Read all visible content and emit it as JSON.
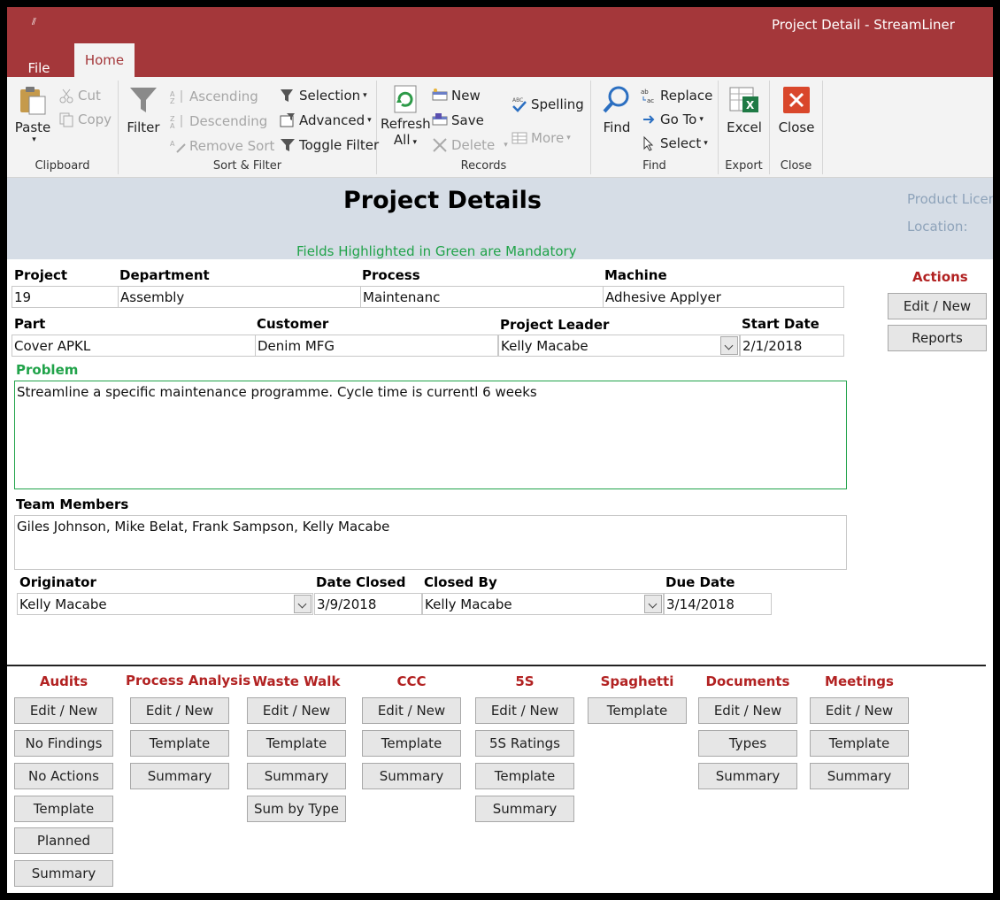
{
  "window": {
    "title": "Project Detail  -  StreamLiner",
    "qat_symbol": "⫽"
  },
  "tabs": {
    "file": "File",
    "home": "Home"
  },
  "ribbon": {
    "clipboard": {
      "label": "Clipboard",
      "paste": "Paste",
      "cut": "Cut",
      "copy": "Copy"
    },
    "sort_filter": {
      "label": "Sort & Filter",
      "filter": "Filter",
      "ascending": "Ascending",
      "descending": "Descending",
      "remove_sort": "Remove Sort",
      "selection": "Selection",
      "advanced": "Advanced",
      "toggle_filter": "Toggle Filter"
    },
    "records": {
      "label": "Records",
      "refresh": "Refresh",
      "refresh_all": "All",
      "new": "New",
      "save": "Save",
      "delete": "Delete",
      "spelling": "Spelling",
      "more": "More"
    },
    "find": {
      "label": "Find",
      "find": "Find",
      "replace": "Replace",
      "goto": "Go To",
      "select": "Select"
    },
    "export": {
      "label": "Export",
      "excel": "Excel"
    },
    "close": {
      "label": "Close",
      "close": "Close"
    }
  },
  "form": {
    "title": "Project Details",
    "mandatory_note": "Fields Highlighted in Green are Mandatory",
    "product_licence": "Product Licen",
    "location": "Location:",
    "project": {
      "label": "Project",
      "value": "19"
    },
    "department": {
      "label": "Department",
      "value": "Assembly"
    },
    "process": {
      "label": "Process",
      "value": "Maintenanc"
    },
    "machine": {
      "label": "Machine",
      "value": "Adhesive Applyer"
    },
    "part": {
      "label": "Part",
      "value": "Cover APKL"
    },
    "customer": {
      "label": "Customer",
      "value": "Denim MFG"
    },
    "project_leader": {
      "label": "Project Leader",
      "value": "Kelly Macabe"
    },
    "start_date": {
      "label": "Start Date",
      "value": "2/1/2018"
    },
    "problem": {
      "label": "Problem",
      "value": "Streamline a specific maintenance programme. Cycle time is currentl 6 weeks"
    },
    "team_members": {
      "label": "Team Members",
      "value": "Giles Johnson, Mike Belat, Frank Sampson, Kelly Macabe"
    },
    "originator": {
      "label": "Originator",
      "value": "Kelly Macabe"
    },
    "date_closed": {
      "label": "Date Closed",
      "value": "3/9/2018"
    },
    "closed_by": {
      "label": "Closed By",
      "value": "Kelly Macabe"
    },
    "due_date": {
      "label": "Due Date",
      "value": "3/14/2018"
    }
  },
  "actions": {
    "label": "Actions",
    "edit_new": "Edit / New",
    "reports": "Reports"
  },
  "sections": [
    {
      "title": "Audits",
      "buttons": [
        "Edit / New",
        "No Findings",
        "No Actions",
        "Template",
        "Planned",
        "Summary"
      ]
    },
    {
      "title": "Process Analysis",
      "buttons": [
        "Edit / New",
        "Template",
        "Summary"
      ]
    },
    {
      "title": "Waste Walk",
      "buttons": [
        "Edit / New",
        "Template",
        "Summary",
        "Sum by Type"
      ]
    },
    {
      "title": "CCC",
      "buttons": [
        "Edit / New",
        "Template",
        "Summary"
      ]
    },
    {
      "title": "5S",
      "buttons": [
        "Edit / New",
        "5S Ratings",
        "Template",
        "Summary"
      ]
    },
    {
      "title": "Spaghetti",
      "buttons": [
        "Template"
      ]
    },
    {
      "title": "Documents",
      "buttons": [
        "Edit / New",
        "Types",
        "Summary"
      ]
    },
    {
      "title": "Meetings",
      "buttons": [
        "Edit / New",
        "Template",
        "Summary"
      ]
    }
  ]
}
